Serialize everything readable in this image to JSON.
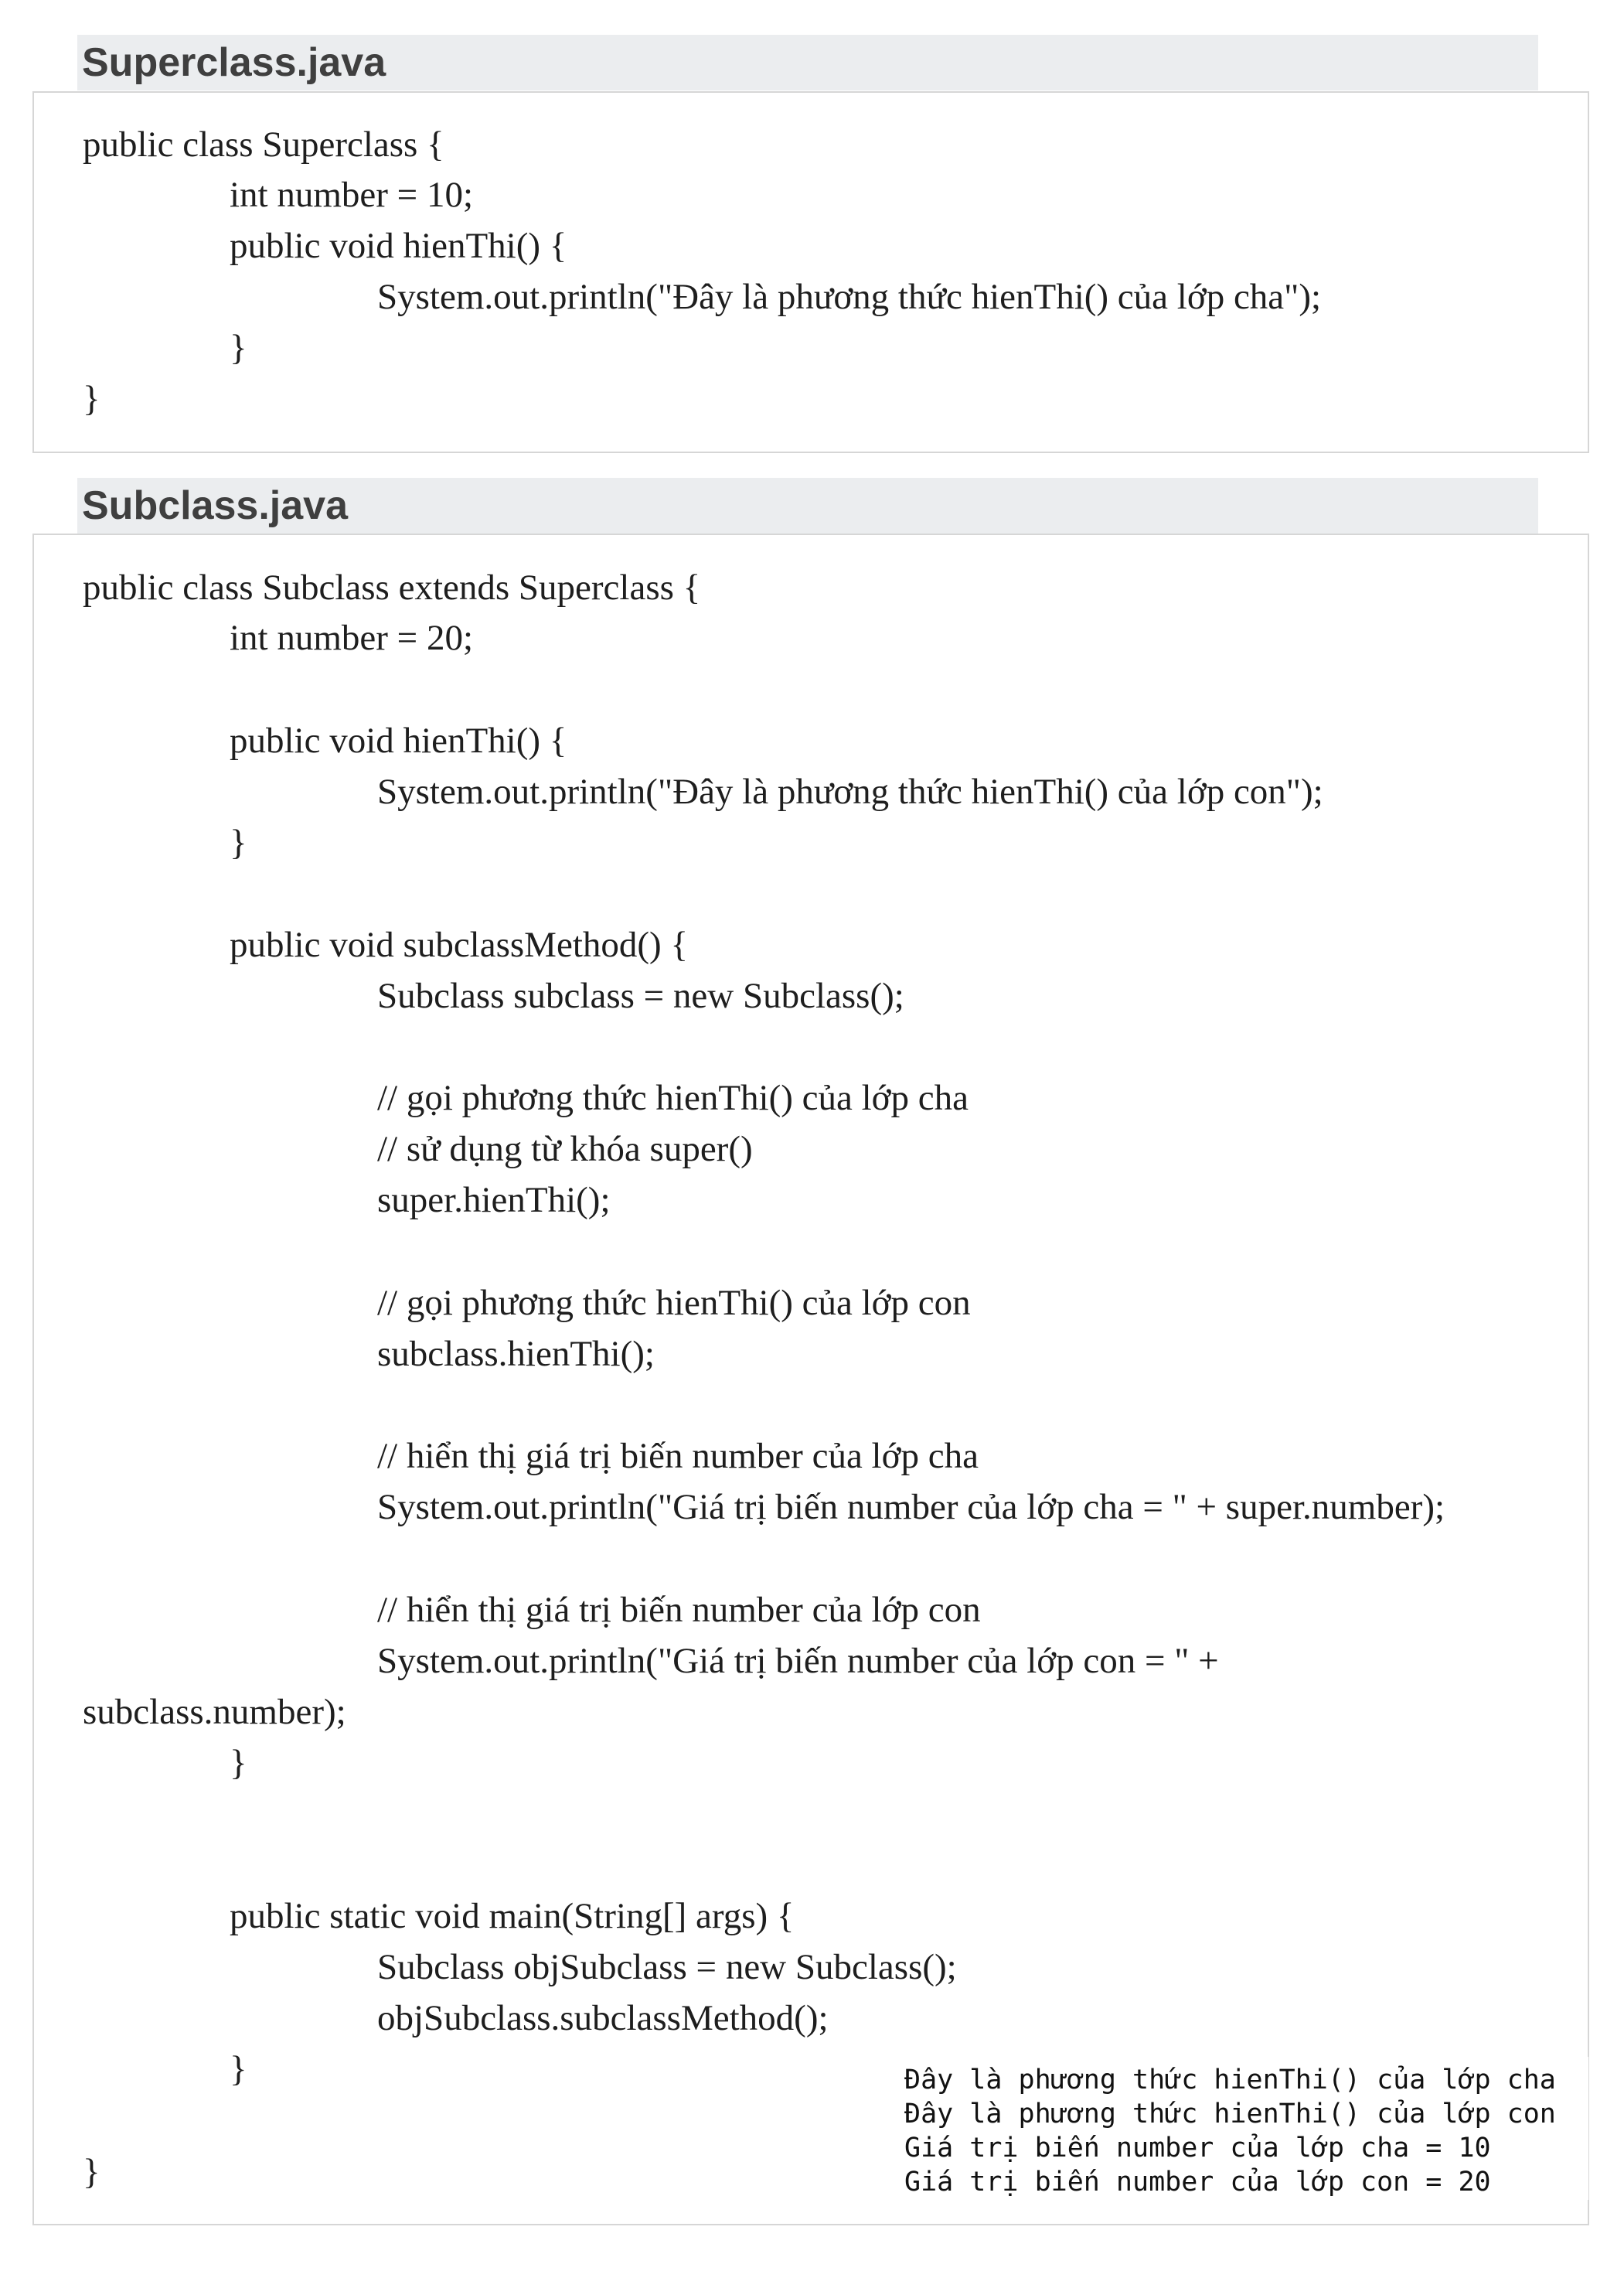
{
  "superclass": {
    "title": "Superclass.java",
    "lines": [
      "public class Superclass {",
      "int number = 10;",
      "public void hienThi() {",
      "System.out.println(\"Đây là phương thức hienThi() của lớp cha\");",
      "}",
      "}"
    ]
  },
  "subclass": {
    "title": "Subclass.java",
    "lines": [
      "public class Subclass extends Superclass {",
      "int number = 20;",
      "public void hienThi() {",
      "System.out.println(\"Đây là phương thức hienThi() của lớp con\");",
      "}",
      "public void subclassMethod() {",
      "Subclass subclass = new Subclass();",
      "// gọi phương thức hienThi() của lớp cha",
      "// sử dụng từ khóa super()",
      "super.hienThi();",
      "// gọi phương thức hienThi() của lớp con",
      "subclass.hienThi();",
      "// hiển thị giá trị biến number của lớp cha",
      "System.out.println(\"Giá trị biến number của lớp cha = \" + super.number);",
      "// hiển thị giá trị biến number của lớp con",
      "System.out.println(\"Giá trị biến number của lớp con = \" +",
      "subclass.number);",
      "}",
      "public static void main(String[] args) {",
      "Subclass objSubclass = new Subclass();",
      "objSubclass.subclassMethod();",
      "}",
      "}"
    ]
  },
  "console_output": {
    "lines": [
      "Đây là phương thức hienThi() của lớp cha",
      "Đây là phương thức hienThi() của lớp con",
      "Giá trị biến number của lớp cha = 10",
      "Giá trị biến number của lớp con = 20"
    ]
  }
}
